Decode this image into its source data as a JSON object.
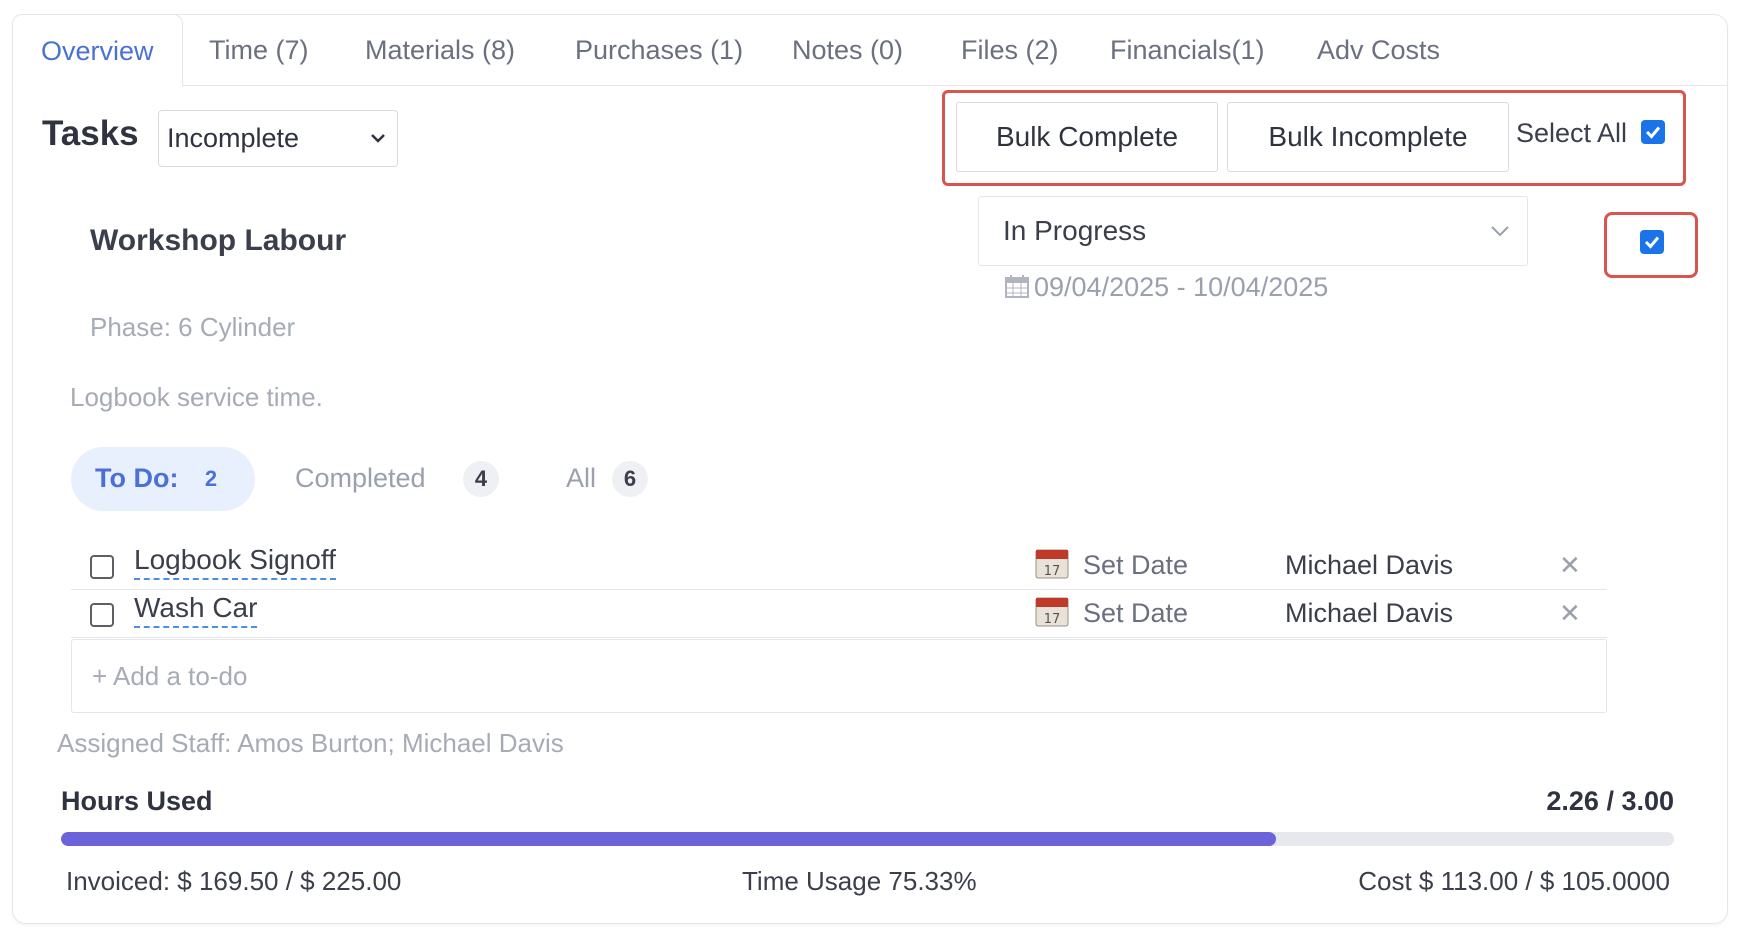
{
  "tabs": [
    {
      "label": "Overview",
      "active": true
    },
    {
      "label": "Time (7)"
    },
    {
      "label": "Materials (8)"
    },
    {
      "label": "Purchases (1)"
    },
    {
      "label": "Notes (0)"
    },
    {
      "label": "Files (2)"
    },
    {
      "label": "Financials(1)"
    },
    {
      "label": "Adv Costs"
    }
  ],
  "tasks": {
    "title": "Tasks",
    "filter_value": "Incomplete",
    "bulk_complete_label": "Bulk Complete",
    "bulk_incomplete_label": "Bulk Incomplete",
    "select_all_label": "Select All",
    "select_all_checked": true
  },
  "task": {
    "name": "Workshop Labour",
    "status": "In Progress",
    "date_range": "09/04/2025 - 10/04/2025",
    "selected": true,
    "phase": "Phase: 6 Cylinder",
    "description": "Logbook service time."
  },
  "filters": {
    "todo_label": "To Do:",
    "todo_count": "2",
    "completed_label": "Completed",
    "completed_count": "4",
    "all_label": "All",
    "all_count": "6"
  },
  "todos": [
    {
      "text": "Logbook Signoff",
      "date": "Set Date",
      "staff": "Michael Davis",
      "done": false
    },
    {
      "text": "Wash Car",
      "date": "Set Date",
      "staff": "Michael Davis",
      "done": false
    }
  ],
  "add_todo_placeholder": "+ Add a to-do",
  "assigned_staff_label": "Assigned Staff:",
  "assigned_staff_value": "Amos Burton; Michael Davis",
  "hours": {
    "label": "Hours Used",
    "value": "2.26 / 3.00",
    "fraction": 0.7533
  },
  "footer": {
    "invoiced": "Invoiced: $ 169.50 / $ 225.00",
    "time_usage": "Time Usage 75.33%",
    "cost": "Cost $ 113.00 / $ 105.0000"
  },
  "colors": {
    "accent": "#4a72d4",
    "progress": "#6c63d8",
    "highlight": "#d9534f",
    "checkbox": "#1a73e8"
  }
}
